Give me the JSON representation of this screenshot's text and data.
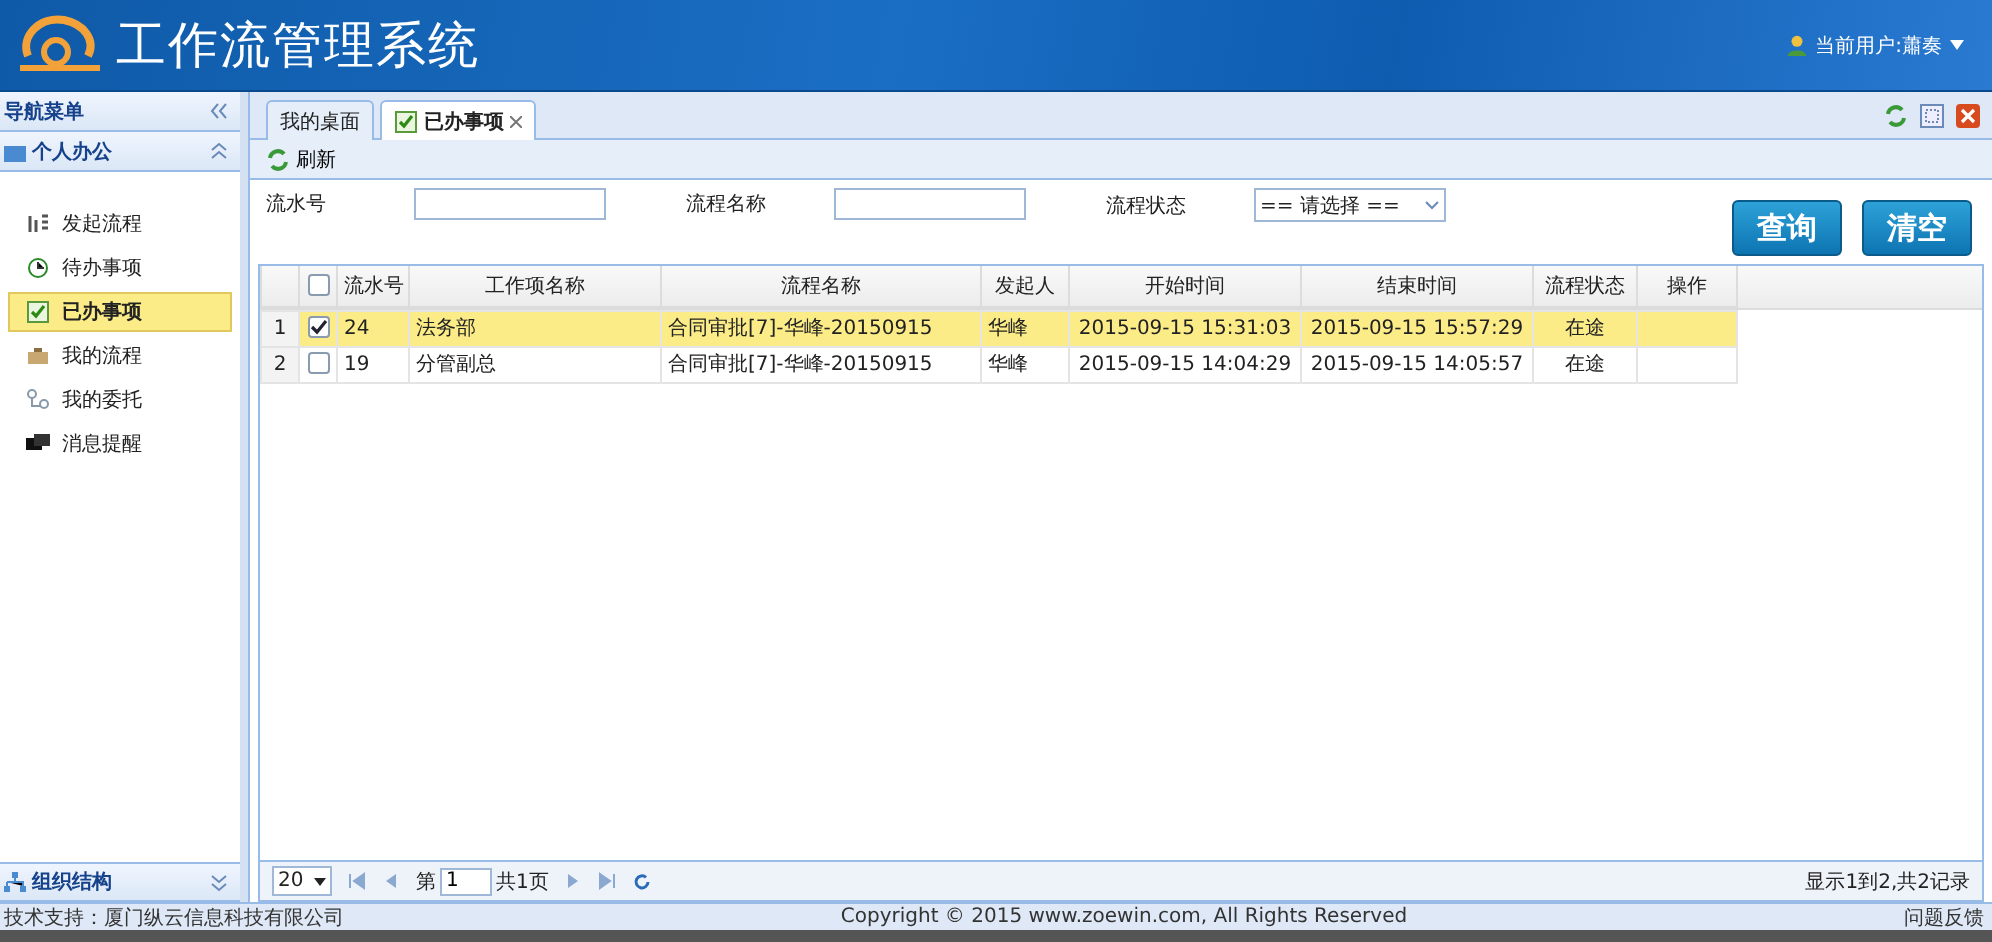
{
  "header": {
    "title": "工作流管理系统",
    "user": "当前用户:蕭奏"
  },
  "sidebar": {
    "title": "导航菜单",
    "section": "个人办公",
    "items": [
      {
        "label": "发起流程",
        "selected": false
      },
      {
        "label": "待办事项",
        "selected": false
      },
      {
        "label": "已办事项",
        "selected": true
      },
      {
        "label": "我的流程",
        "selected": false
      },
      {
        "label": "我的委托",
        "selected": false
      },
      {
        "label": "消息提醒",
        "selected": false
      }
    ],
    "bottom_section": "组织结构"
  },
  "tabs": [
    {
      "label": "我的桌面",
      "selected": false,
      "closable": false
    },
    {
      "label": "已办事项",
      "selected": true,
      "closable": true
    }
  ],
  "toolbar": {
    "refresh": "刷新"
  },
  "search": {
    "fields": [
      {
        "label": "流水号",
        "kind": "text"
      },
      {
        "label": "流程名称",
        "kind": "text"
      },
      {
        "label": "流程状态",
        "kind": "select",
        "value": "== 请选择 =="
      }
    ],
    "buttons": [
      "查询",
      "清空"
    ]
  },
  "table": {
    "all_checked": false,
    "columns": [
      "流水号",
      "工作项名称",
      "流程名称",
      "发起人",
      "开始时间",
      "结束时间",
      "流程状态",
      "操作"
    ],
    "rows": [
      {
        "num": "1",
        "checked": true,
        "selected": true,
        "cells": [
          "24",
          "法务部",
          "合同审批[7]-华峰-20150915",
          "华峰",
          "2015-09-15 15:31:03",
          "2015-09-15 15:57:29",
          "在途",
          ""
        ]
      },
      {
        "num": "2",
        "checked": false,
        "selected": false,
        "cells": [
          "19",
          "分管副总",
          "合同审批[7]-华峰-20150915",
          "华峰",
          "2015-09-15 14:04:29",
          "2015-09-15 14:05:57",
          "在途",
          ""
        ]
      }
    ]
  },
  "pager": {
    "page_size": "20",
    "page_prefix": "第",
    "page": "1",
    "page_total": "共1页",
    "summary": "显示1到2,共2记录"
  },
  "footer": {
    "support": "技术支持：厦门纵云信息科技有限公司",
    "copyright": "Copyright © 2015 www.zoewin.com, All Rights Reserved",
    "feedback": "问题反馈"
  }
}
